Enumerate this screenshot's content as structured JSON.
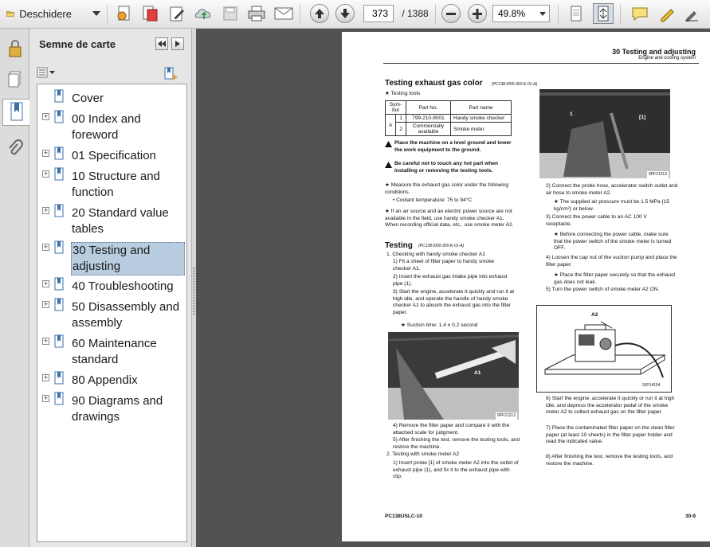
{
  "toolbar": {
    "open_label": "Deschidere",
    "page_current": "373",
    "page_total": "/ 1388",
    "zoom": "49.8%"
  },
  "panel": {
    "title": "Semne de carte",
    "bookmarks": [
      {
        "label": "Cover",
        "expandable": false
      },
      {
        "label": "00 Index and foreword",
        "expandable": true
      },
      {
        "label": "01 Specification",
        "expandable": true
      },
      {
        "label": "10 Structure and function",
        "expandable": true
      },
      {
        "label": "20 Standard value tables",
        "expandable": true
      },
      {
        "label": "30 Testing and adjusting",
        "expandable": true,
        "selected": true
      },
      {
        "label": "40 Troubleshooting",
        "expandable": true
      },
      {
        "label": "50 Disassembly and assembly",
        "expandable": true
      },
      {
        "label": "60 Maintenance standard",
        "expandable": true
      },
      {
        "label": "80 Appendix",
        "expandable": true
      },
      {
        "label": "90 Diagrams and drawings",
        "expandable": true
      }
    ]
  },
  "doc": {
    "header_title": "30 Testing and adjusting",
    "header_sub": "Engine and cooling system",
    "section_title": "Testing exhaust gas color",
    "section_code": "(PC138-I000-360-K-01-A)",
    "testing_tools": "★  Testing tools",
    "table": {
      "headers": [
        "Sym-bol",
        "Part No.",
        "Part name"
      ],
      "group": "A",
      "rows": [
        {
          "num": "1",
          "part_no": "799-210-9001",
          "name": "Handy smoke checker"
        },
        {
          "num": "2",
          "part_no": "Commercially available",
          "name": "Smoke meter"
        }
      ]
    },
    "warn1": "Place the machine on a level ground and lower the work equipment to the ground.",
    "warn2": "Be careful not to touch any hot part when installing or removing the testing tools.",
    "note1": "★  Measure the exhaust gas color under the following conditions.",
    "note1b": "•  Coolant temperature: 75 to 94°C",
    "note2": "★  If an air source and an electric power source are not available in the field, use handy smoke checker A1. When recording official data, etc., use smoke meter A2.",
    "testing_title": "Testing",
    "testing_code": "(PC138-I000-355-K-01-A)",
    "steps_left": [
      "1.  Checking with handy smoke checker A1",
      "1)  Fit a sheet of filter paper to handy smoke checker A1.",
      "2)  Insert the exhaust gas intake pipe into exhaust pipe (1).",
      "3)  Start the engine, accelerate it quickly and run it at high idle, and operate the handle of handy smoke checker A1 to absorb the exhaust gas into the filter paper.",
      "★  Suction time: 1.4 ± 0.2 second"
    ],
    "photo1_label": "A1",
    "photo1_code": "9PF21212",
    "steps_left2": [
      "4)  Remove the filter paper and compare it with the attached scale for judgment.",
      "5)  After finishing the test, remove the testing tools, and restore the machine.",
      "2.  Testing with smoke meter A2",
      "1)  Insert probe [1] of smoke meter A2 into the outlet of exhaust pipe (1), and fix it to the exhaust pipe with clip."
    ],
    "photo2_label1": "1",
    "photo2_label2": "[1]",
    "photo2_code": "9PF21213",
    "steps_right": [
      "2)  Connect the probe hose, accelerator switch outlet and air hose to smoke meter A2.",
      "★  The supplied air pressure must be 1.5 MPa {15 kg/cm²} or below.",
      "3)  Connect the power cable to an AC 100 V receptacle.",
      "★  Before connecting the power cable, make sure that the power switch of the smoke meter is turned OFF.",
      "4)  Loosen the cap nut of the suction pump and place the filter paper.",
      "★  Place the filter paper securely so that the exhaust gas does not leak.",
      "5)  Turn the power switch of smoke meter A2 ON."
    ],
    "fig_label": "A2",
    "fig_code": "9JP14154",
    "steps_right2": [
      "6)  Start the engine, accelerate it quickly or run it at high idle, and depress the accelerator pedal of the smoke meter A2 to collect exhaust gas on the filter paper.",
      "7)  Place the contaminated filter paper on the clean filter paper (at least 10 sheets) in the filter paper holder and read the indicated value.",
      "8)  After finishing the test, remove the testing tools, and restore the machine."
    ],
    "footer_left": "PC138USLC-10",
    "footer_right": "30-9"
  }
}
